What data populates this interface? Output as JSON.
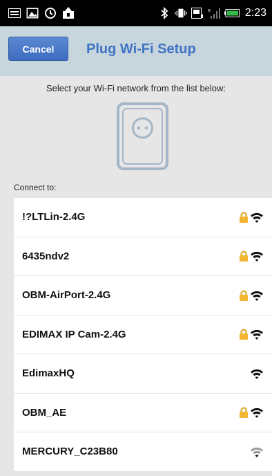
{
  "status_bar": {
    "time": "2:23",
    "colors": {
      "background": "#000000",
      "battery": "#35b94a"
    }
  },
  "header": {
    "cancel_label": "Cancel",
    "title": "Plug Wi-Fi Setup",
    "colors": {
      "background": "#c7d6dd",
      "title": "#3f73c4",
      "button": "#4a78c8"
    }
  },
  "main": {
    "instruction": "Select your Wi-Fi network from the list below:",
    "connect_label": "Connect to:",
    "illustration_icon": "smart-plug-icon"
  },
  "networks": [
    {
      "name": "!?LTLin-2.4G",
      "locked": true,
      "signal": "full"
    },
    {
      "name": "6435ndv2",
      "locked": true,
      "signal": "full"
    },
    {
      "name": "OBM-AirPort-2.4G",
      "locked": true,
      "signal": "full"
    },
    {
      "name": "EDIMAX IP Cam-2.4G",
      "locked": true,
      "signal": "full"
    },
    {
      "name": "EdimaxHQ",
      "locked": false,
      "signal": "full"
    },
    {
      "name": "OBM_AE",
      "locked": true,
      "signal": "full"
    },
    {
      "name": "MERCURY_C23B80",
      "locked": false,
      "signal": "weak"
    }
  ]
}
